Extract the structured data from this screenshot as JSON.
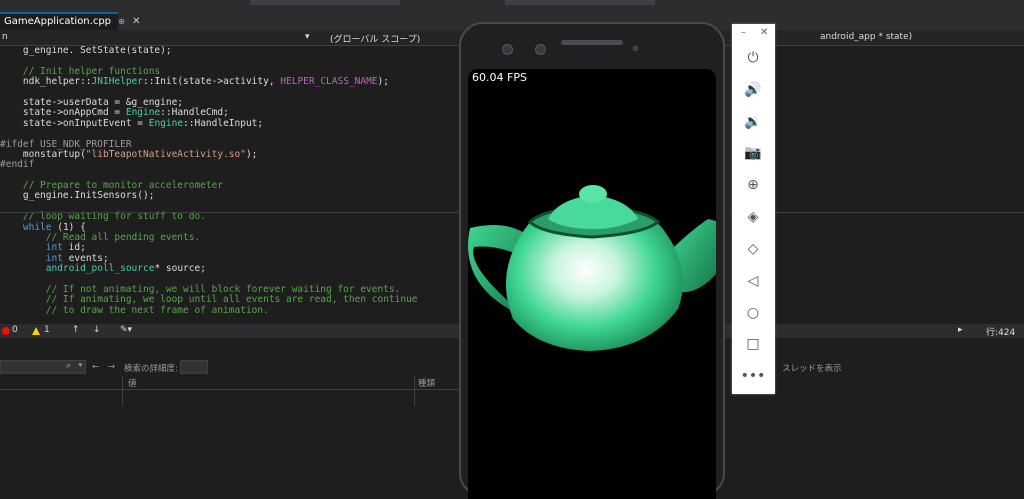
{
  "tab": {
    "title": "GameApplication.cpp",
    "pin": "⊕",
    "close": "✕"
  },
  "nav": {
    "left": "n",
    "scope": "(グローバル スコープ)",
    "right": "android_app * state)"
  },
  "code_lines": [
    "    g_engine. SetState(state);",
    "",
    "    // Init helper functions",
    "    ndk_helper::JNIHelper::Init(state->activity, HELPER_CLASS_NAME);",
    "",
    "    state->userData = &g_engine;",
    "    state->onAppCmd = Engine::HandleCmd;",
    "    state->onInputEvent = Engine::HandleInput;",
    "",
    "#ifdef USE_NDK_PROFILER",
    "    monstartup(\"libTeapotNativeActivity.so\");",
    "#endif",
    "",
    "    // Prepare to monitor accelerometer",
    "    g_engine.InitSensors();",
    "",
    "    // loop waiting for stuff to do.",
    "    while (1) {",
    "        // Read all pending events.",
    "        int id;",
    "        int events;",
    "        android_poll_source* source;",
    "",
    "        // If not animating, we will block forever waiting for events.",
    "        // If animating, we loop until all events are read, then continue",
    "        // to draw the next frame of animation."
  ],
  "status": {
    "errors": "0",
    "warnings": "1",
    "line": "行:424"
  },
  "lower": {
    "search_icon": "search-icon",
    "depth_label": "検索の詳細度:",
    "col_value": "値",
    "col_type": "種類",
    "thread_label": "スレッドを表示"
  },
  "emulator": {
    "fps": "60.04 FPS",
    "buttons": [
      "power",
      "volume-up",
      "volume-down",
      "camera",
      "zoom",
      "rotate-left",
      "rotate-right",
      "back",
      "home",
      "overview",
      "more"
    ]
  }
}
